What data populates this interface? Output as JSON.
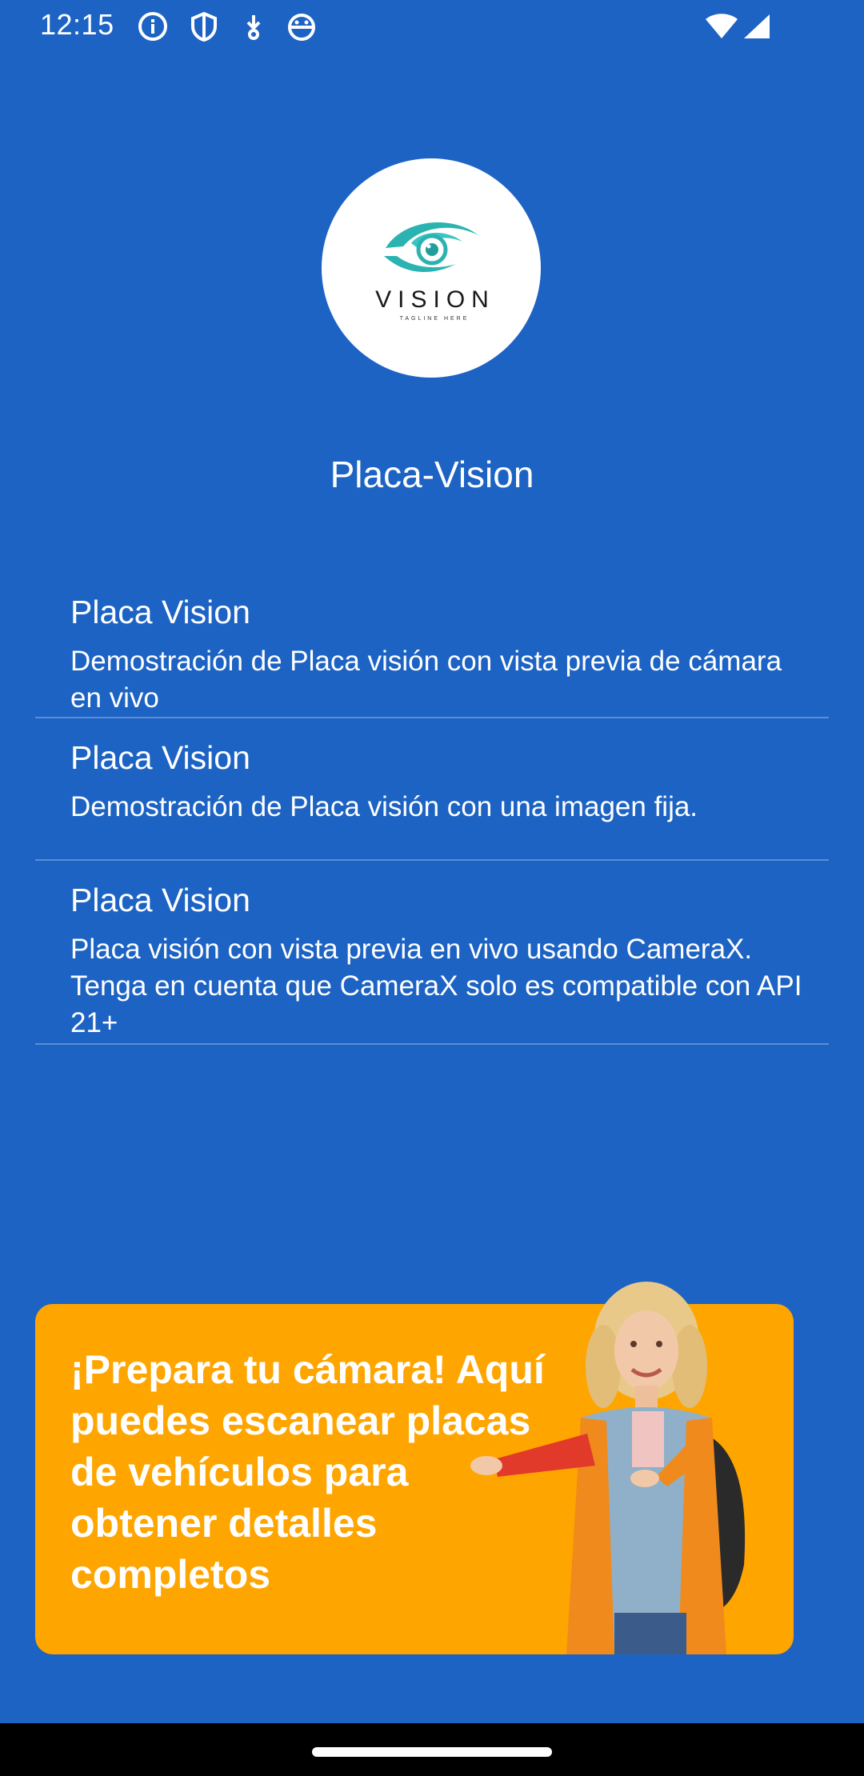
{
  "status_bar": {
    "time": "12:15",
    "icons_left": [
      "info-icon",
      "shield-icon",
      "download-icon",
      "android-icon"
    ],
    "icons_right": [
      "wifi-icon",
      "signal-icon"
    ]
  },
  "logo": {
    "brand": "VISION",
    "tagline": "TAGLINE HERE",
    "colors": {
      "eye": "#2bb3b1",
      "text": "#1a1a1a"
    }
  },
  "app": {
    "title": "Placa-Vision"
  },
  "list": {
    "items": [
      {
        "title": "Placa Vision",
        "description": "Demostración de Placa visión con vista previa de cámara en vivo"
      },
      {
        "title": "Placa Vision",
        "description": "Demostración de Placa visión con una imagen fija."
      },
      {
        "title": "Placa Vision",
        "description": "Placa visión con vista previa en vivo usando CameraX. Tenga en cuenta que CameraX solo es compatible con API 21+"
      }
    ]
  },
  "banner": {
    "text": "¡Prepara tu cámara! Aquí puedes escanear placas de vehículos para obtener detalles completos",
    "background": "#ffa500"
  },
  "theme": {
    "background": "#1d63c4",
    "text": "#ffffff"
  }
}
